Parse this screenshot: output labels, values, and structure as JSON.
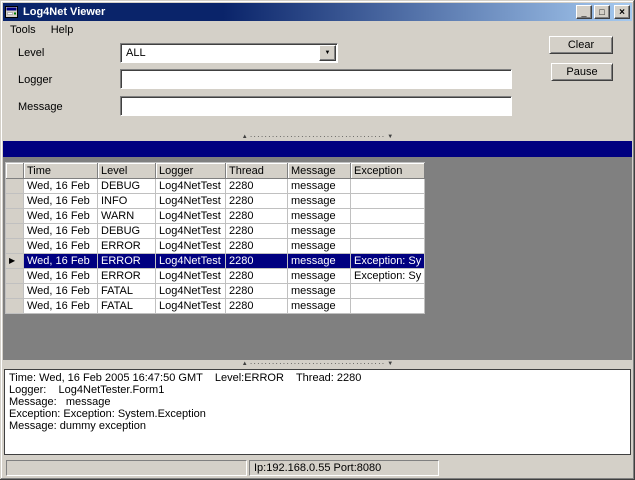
{
  "window": {
    "title": "Log4Net Viewer",
    "menu": [
      "Tools",
      "Help"
    ]
  },
  "icons": {
    "minimize": "_",
    "maximize": "□",
    "close": "×",
    "dropdown": "▼",
    "row_pointer": "▶",
    "splitter_up": "▲",
    "splitter_down": "▼",
    "splitter_dots": "·····································"
  },
  "filters": {
    "level_label": "Level",
    "level_value": "ALL",
    "logger_label": "Logger",
    "logger_value": "",
    "message_label": "Message",
    "message_value": "",
    "clear_button": "Clear",
    "pause_button": "Pause"
  },
  "grid": {
    "columns": [
      "Time",
      "Level",
      "Logger",
      "Thread",
      "Message",
      "Exception"
    ],
    "selected_index": 5,
    "rows": [
      {
        "time": "Wed, 16 Feb",
        "level": "DEBUG",
        "logger": "Log4NetTest",
        "thread": "2280",
        "message": "message",
        "exception": ""
      },
      {
        "time": "Wed, 16 Feb",
        "level": "INFO",
        "logger": "Log4NetTest",
        "thread": "2280",
        "message": "message",
        "exception": ""
      },
      {
        "time": "Wed, 16 Feb",
        "level": "WARN",
        "logger": "Log4NetTest",
        "thread": "2280",
        "message": "message",
        "exception": ""
      },
      {
        "time": "Wed, 16 Feb",
        "level": "DEBUG",
        "logger": "Log4NetTest",
        "thread": "2280",
        "message": "message",
        "exception": ""
      },
      {
        "time": "Wed, 16 Feb",
        "level": "ERROR",
        "logger": "Log4NetTest",
        "thread": "2280",
        "message": "message",
        "exception": ""
      },
      {
        "time": "Wed, 16 Feb",
        "level": "ERROR",
        "logger": "Log4NetTest",
        "thread": "2280",
        "message": "message",
        "exception": "Exception: Sy"
      },
      {
        "time": "Wed, 16 Feb",
        "level": "ERROR",
        "logger": "Log4NetTest",
        "thread": "2280",
        "message": "message",
        "exception": "Exception: Sy"
      },
      {
        "time": "Wed, 16 Feb",
        "level": "FATAL",
        "logger": "Log4NetTest",
        "thread": "2280",
        "message": "message",
        "exception": ""
      },
      {
        "time": "Wed, 16 Feb",
        "level": "FATAL",
        "logger": "Log4NetTest",
        "thread": "2280",
        "message": "message",
        "exception": ""
      }
    ]
  },
  "detail": {
    "lines": [
      "Time: Wed, 16 Feb 2005 16:47:50 GMT    Level:ERROR    Thread: 2280",
      "Logger:    Log4NetTester.Form1",
      "Message:   message",
      "Exception: Exception: System.Exception",
      "Message: dummy exception"
    ]
  },
  "status_bar": {
    "text": "Ip:192.168.0.55 Port:8080"
  },
  "colors": {
    "chrome": "#d4d0c8",
    "caption_navy": "#000080",
    "selection": "#000080",
    "grid_background": "#808080",
    "titlebar_gradient_start": "#0a246a",
    "titlebar_gradient_end": "#a6caf0"
  }
}
